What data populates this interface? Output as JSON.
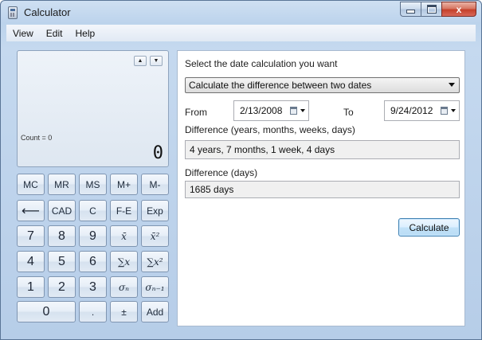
{
  "window": {
    "title": "Calculator",
    "close_glyph": "x"
  },
  "menu": [
    {
      "label": "View"
    },
    {
      "label": "Edit"
    },
    {
      "label": "Help"
    }
  ],
  "display": {
    "history_up": "▲",
    "history_down": "▼",
    "count_label": "Count = 0",
    "value": "0"
  },
  "keypad": {
    "mc": "MC",
    "mr": "MR",
    "ms": "MS",
    "mplus": "M+",
    "mminus": "M-",
    "backspace": "⟵",
    "cad": "CAD",
    "c": "C",
    "fe": "F-E",
    "exp": "Exp",
    "d7": "7",
    "d8": "8",
    "d9": "9",
    "mean": "x̄",
    "mean_sq": "x̄²",
    "d4": "4",
    "d5": "5",
    "d6": "6",
    "sum": "∑x",
    "sum_sq": "∑x²",
    "d1": "1",
    "d2": "2",
    "d3": "3",
    "sigma_n": "σₙ",
    "sigma_n1": "σₙ₋₁",
    "d0": "0",
    "dot": ".",
    "sign": "±",
    "add": "Add"
  },
  "date_calc": {
    "prompt": "Select the date calculation you want",
    "mode": "Calculate the difference between two dates",
    "from_label": "From",
    "from_value": "2/13/2008",
    "to_label": "To",
    "to_value": "9/24/2012",
    "diff_label": "Difference (years, months, weeks, days)",
    "diff_value": "4 years, 7 months, 1 week, 4 days",
    "days_label": "Difference (days)",
    "days_value": "1685 days",
    "calculate_label": "Calculate"
  }
}
